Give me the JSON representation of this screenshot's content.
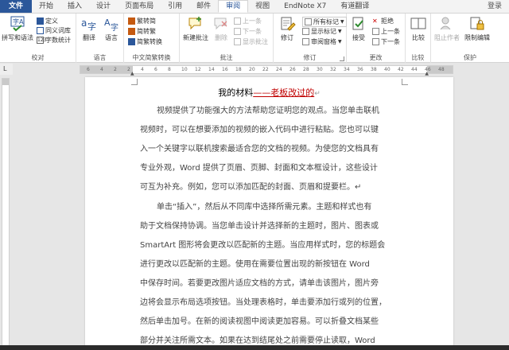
{
  "tabs": [
    "文件",
    "开始",
    "插入",
    "设计",
    "页面布局",
    "引用",
    "邮件",
    "审阅",
    "视图",
    "EndNote X7",
    "有道翻译"
  ],
  "login_label": "登录",
  "ribbon": {
    "proofing": {
      "label": "校对",
      "big": "拼写和语法",
      "items": [
        "定义",
        "同义词库",
        "字数统计"
      ]
    },
    "language": {
      "label": "语言",
      "translate": "翻译",
      "language": "语言"
    },
    "chinese": {
      "label": "中文简繁转换",
      "items": [
        "繁转简",
        "简转繁",
        "简繁转换"
      ]
    },
    "comments": {
      "label": "批注",
      "new_comment": "新建批注",
      "delete": "删除",
      "items": [
        "上一条",
        "下一条",
        "显示批注"
      ]
    },
    "tracking": {
      "label": "修订",
      "track": "修订",
      "items": [
        "所有标记",
        "显示标记",
        "审阅窗格"
      ]
    },
    "changes": {
      "label": "更改",
      "accept": "接受",
      "items": [
        "拒绝",
        "上一条",
        "下一条"
      ]
    },
    "compare": {
      "label": "比较",
      "compare": "比较"
    },
    "protect": {
      "label": "保护",
      "block_authors": "阻止作者",
      "restrict": "限制编辑"
    }
  },
  "ruler": {
    "numbers": [
      "6",
      "4",
      "2",
      "2",
      "4",
      "6",
      "8",
      "10",
      "12",
      "14",
      "16",
      "18",
      "20",
      "22",
      "24",
      "26",
      "28",
      "30",
      "32",
      "34",
      "36",
      "38",
      "40",
      "42",
      "44",
      "46",
      "48"
    ]
  },
  "document": {
    "title_main": "我的材料",
    "title_revision": "——老板改过的",
    "title_mark": "↵",
    "para1": [
      "视频提供了功能强大的方法帮助您证明您的观点。当您单击联机",
      "视频时，可以在想要添加的视频的嵌入代码中进行粘贴。您也可以键",
      "入一个关键字以联机搜索最适合您的文档的视频。为使您的文档具有",
      "专业外观，Word 提供了页眉、页脚、封面和文本框设计，这些设计",
      "可互为补充。例如，您可以添加匹配的封面、页眉和提要栏。↵"
    ],
    "para2": [
      "单击“插入”，然后从不同库中选择所需元素。主题和样式也有",
      "助于文档保持协调。当您单击设计并选择新的主题时，图片、图表或",
      "SmartArt 图形将会更改以匹配新的主题。当应用样式时，您的标题会",
      "进行更改以匹配新的主题。使用在需要位置出现的新按钮在 Word",
      "中保存时间。若要更改图片适应文档的方式，请单击该图片，图片旁",
      "边将会显示布局选项按钮。当处理表格时，单击要添加行或列的位置，",
      "然后单击加号。在新的阅读视图中阅读更加容易。可以折叠文档某些",
      "部分并关注所需文本。如果在达到结尾处之前需要停止读取，Word"
    ]
  },
  "colors": {
    "file_tab": "#2b579a",
    "revision": "#c00000",
    "status_bar": "#2b2b2b"
  }
}
